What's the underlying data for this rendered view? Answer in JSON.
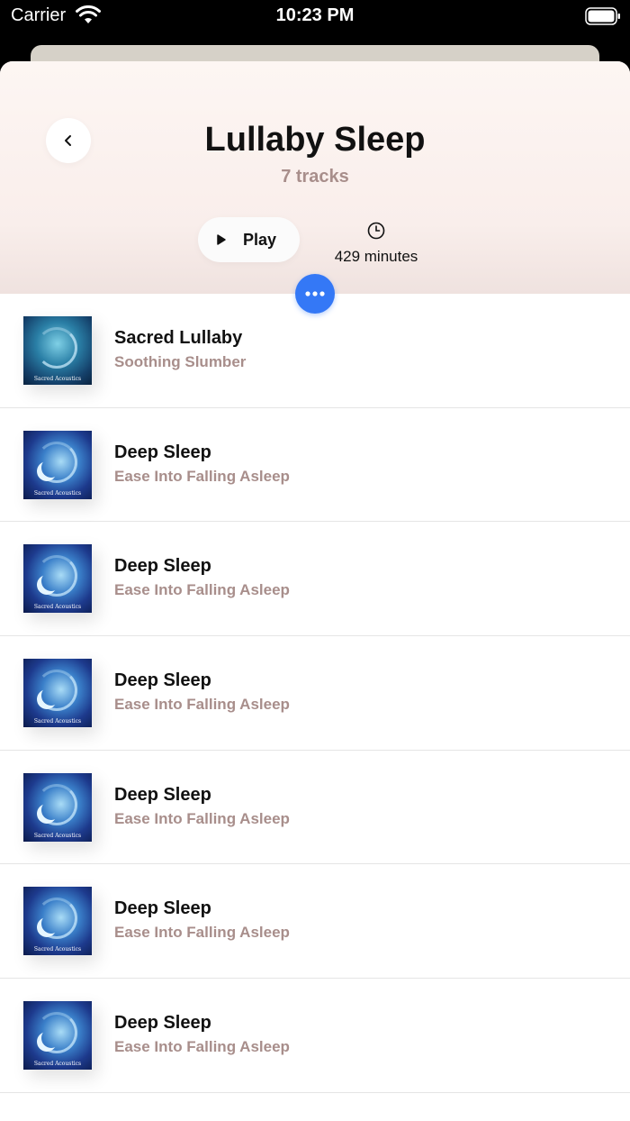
{
  "status_bar": {
    "carrier": "Carrier",
    "time": "10:23 PM",
    "wifi_icon": "wifi-icon",
    "battery_icon": "battery-icon"
  },
  "header": {
    "back_icon": "chevron-left-icon",
    "title": "Lullaby Sleep",
    "subtitle": "7 tracks",
    "play_label": "Play",
    "play_icon": "play-icon",
    "duration_icon": "clock-icon",
    "duration_label": "429 minutes",
    "more_icon": "ellipsis-icon"
  },
  "colors": {
    "accent": "#3478f6",
    "subtitle": "#a88e8b",
    "header_bg": "#fdf6f3"
  },
  "tracks": [
    {
      "title": "Sacred Lullaby",
      "subtitle": "Soothing Slumber",
      "art_label": "Sacred Acoustics"
    },
    {
      "title": "Deep Sleep",
      "subtitle": "Ease Into Falling Asleep",
      "art_label": "Sacred Acoustics"
    },
    {
      "title": "Deep Sleep",
      "subtitle": "Ease Into Falling Asleep",
      "art_label": "Sacred Acoustics"
    },
    {
      "title": "Deep Sleep",
      "subtitle": "Ease Into Falling Asleep",
      "art_label": "Sacred Acoustics"
    },
    {
      "title": "Deep Sleep",
      "subtitle": "Ease Into Falling Asleep",
      "art_label": "Sacred Acoustics"
    },
    {
      "title": "Deep Sleep",
      "subtitle": "Ease Into Falling Asleep",
      "art_label": "Sacred Acoustics"
    },
    {
      "title": "Deep Sleep",
      "subtitle": "Ease Into Falling Asleep",
      "art_label": "Sacred Acoustics"
    }
  ]
}
